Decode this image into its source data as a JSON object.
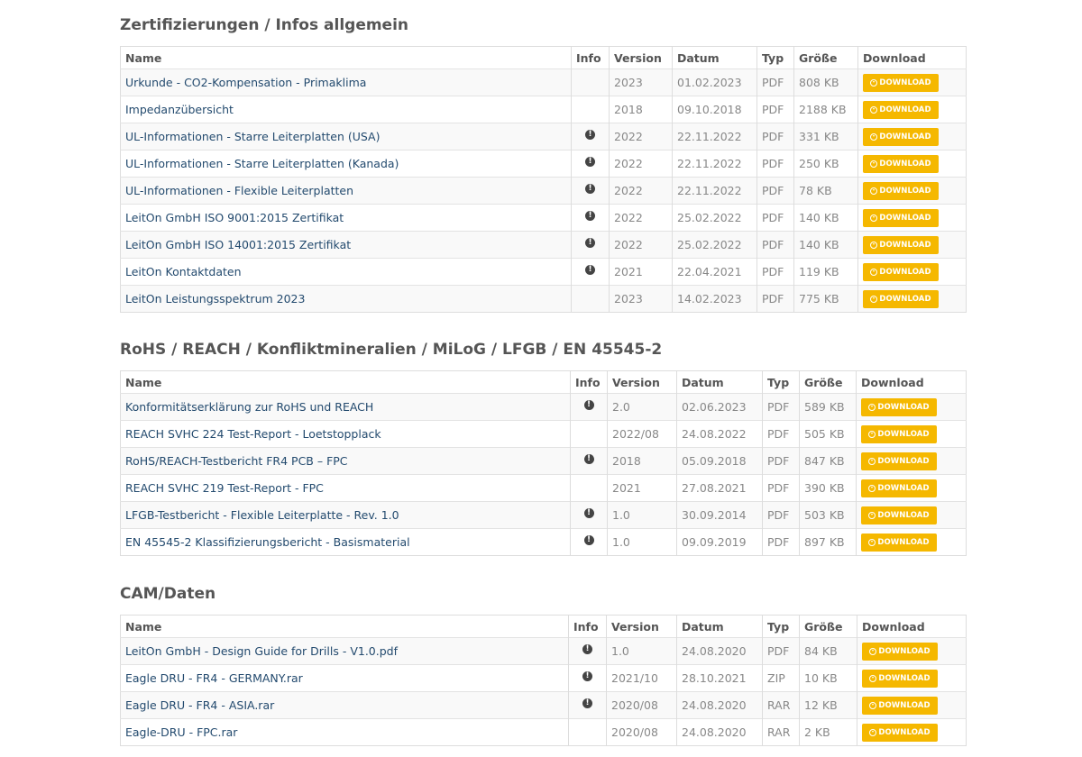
{
  "columns": {
    "name": "Name",
    "info": "Info",
    "version": "Version",
    "datum": "Datum",
    "typ": "Typ",
    "groesse": "Größe",
    "download": "Download"
  },
  "download_label": "DOWNLOAD",
  "accent_color": "#f5b800",
  "sections": [
    {
      "title": "Zertifizierungen / Infos allgemein",
      "rows": [
        {
          "name": "Urkunde - CO2-Kompensation - Primaklima",
          "info": false,
          "version": "2023",
          "datum": "01.02.2023",
          "typ": "PDF",
          "size": "808 KB"
        },
        {
          "name": "Impedanzübersicht",
          "info": false,
          "version": "2018",
          "datum": "09.10.2018",
          "typ": "PDF",
          "size": "2188 KB"
        },
        {
          "name": "UL-Informationen - Starre Leiterplatten (USA)",
          "info": true,
          "version": "2022",
          "datum": "22.11.2022",
          "typ": "PDF",
          "size": "331 KB"
        },
        {
          "name": "UL-Informationen - Starre Leiterplatten (Kanada)",
          "info": true,
          "version": "2022",
          "datum": "22.11.2022",
          "typ": "PDF",
          "size": "250 KB"
        },
        {
          "name": "UL-Informationen - Flexible Leiterplatten",
          "info": true,
          "version": "2022",
          "datum": "22.11.2022",
          "typ": "PDF",
          "size": "78 KB"
        },
        {
          "name": "LeitOn GmbH ISO 9001:2015 Zertifikat",
          "info": true,
          "version": "2022",
          "datum": "25.02.2022",
          "typ": "PDF",
          "size": "140 KB"
        },
        {
          "name": "LeitOn GmbH ISO 14001:2015 Zertifikat",
          "info": true,
          "version": "2022",
          "datum": "25.02.2022",
          "typ": "PDF",
          "size": "140 KB"
        },
        {
          "name": "LeitOn Kontaktdaten",
          "info": true,
          "version": "2021",
          "datum": "22.04.2021",
          "typ": "PDF",
          "size": "119 KB"
        },
        {
          "name": "LeitOn Leistungsspektrum 2023",
          "info": false,
          "version": "2023",
          "datum": "14.02.2023",
          "typ": "PDF",
          "size": "775 KB"
        }
      ]
    },
    {
      "title": "RoHS / REACH / Konfliktmineralien / MiLoG / LFGB / EN 45545-2",
      "rows": [
        {
          "name": "Konformitätserklärung zur RoHS und REACH",
          "info": true,
          "version": "2.0",
          "datum": "02.06.2023",
          "typ": "PDF",
          "size": "589 KB"
        },
        {
          "name": "REACH SVHC 224 Test-Report - Loetstopplack",
          "info": false,
          "version": "2022/08",
          "datum": "24.08.2022",
          "typ": "PDF",
          "size": "505 KB"
        },
        {
          "name": "RoHS/REACH-Testbericht FR4 PCB – FPC",
          "info": true,
          "version": "2018",
          "datum": "05.09.2018",
          "typ": "PDF",
          "size": "847 KB"
        },
        {
          "name": "REACH SVHC 219 Test-Report - FPC",
          "info": false,
          "version": "2021",
          "datum": "27.08.2021",
          "typ": "PDF",
          "size": "390 KB"
        },
        {
          "name": "LFGB-Testbericht - Flexible Leiterplatte - Rev. 1.0",
          "info": true,
          "version": "1.0",
          "datum": "30.09.2014",
          "typ": "PDF",
          "size": "503 KB"
        },
        {
          "name": "EN 45545-2 Klassifizierungsbericht - Basismaterial",
          "info": true,
          "version": "1.0",
          "datum": "09.09.2019",
          "typ": "PDF",
          "size": "897 KB"
        }
      ]
    },
    {
      "title": "CAM/Daten",
      "rows": [
        {
          "name": "LeitOn GmbH - Design Guide for Drills - V1.0.pdf",
          "info": true,
          "version": "1.0",
          "datum": "24.08.2020",
          "typ": "PDF",
          "size": "84 KB"
        },
        {
          "name": "Eagle DRU - FR4 - GERMANY.rar",
          "info": true,
          "version": "2021/10",
          "datum": "28.10.2021",
          "typ": "ZIP",
          "size": "10 KB"
        },
        {
          "name": "Eagle DRU - FR4 - ASIA.rar",
          "info": true,
          "version": "2020/08",
          "datum": "24.08.2020",
          "typ": "RAR",
          "size": "12 KB"
        },
        {
          "name": "Eagle-DRU - FPC.rar",
          "info": false,
          "version": "2020/08",
          "datum": "24.08.2020",
          "typ": "RAR",
          "size": "2 KB"
        }
      ]
    }
  ]
}
